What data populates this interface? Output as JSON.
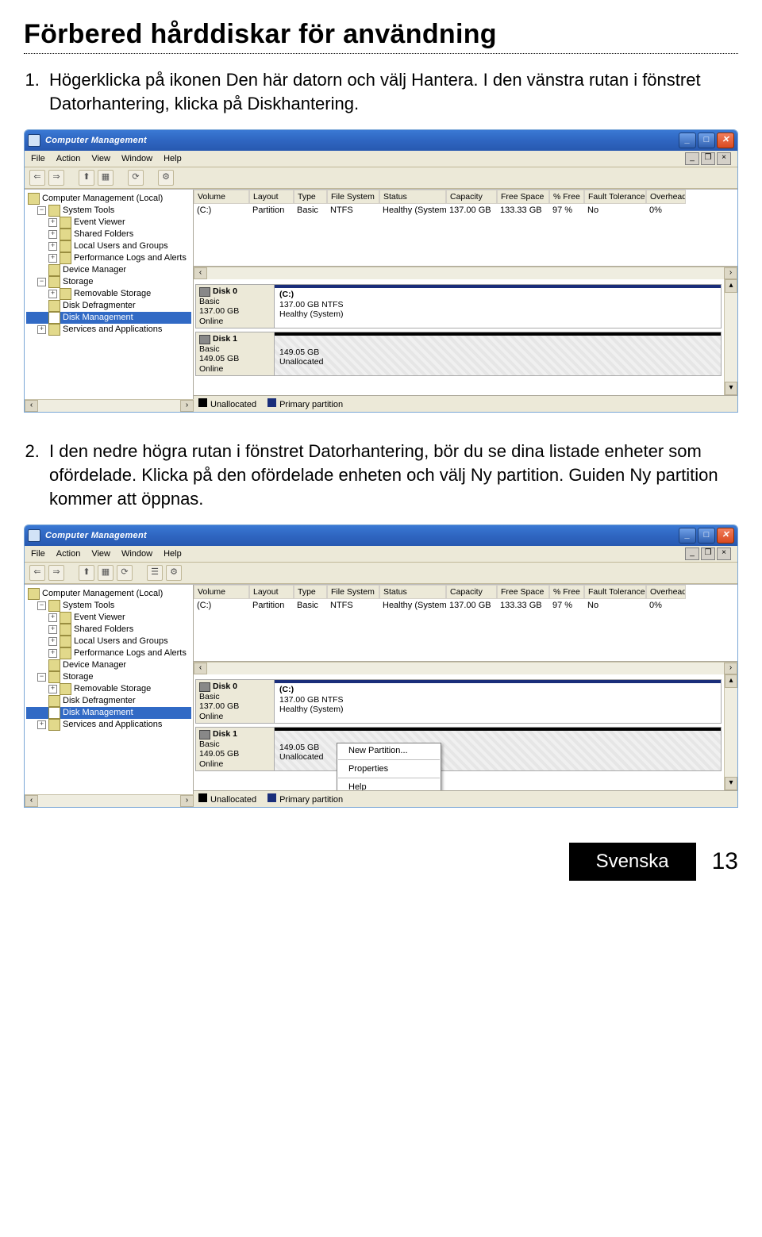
{
  "heading": "Förbered hårddiskar för användning",
  "step1": "Högerklicka på ikonen Den här datorn och välj Hantera. I den vänstra rutan i fönstret Datorhantering, klicka på Diskhantering.",
  "step2": "I den nedre högra rutan i fönstret Datorhantering, bör du se dina listade enheter som ofördelade. Klicka på den ofördelade enheten och välj Ny partition. Guiden Ny partition kommer att öppnas.",
  "window": {
    "title": "Computer Management",
    "menus": {
      "file": "File",
      "action": "Action",
      "view": "View",
      "window": "Window",
      "help": "Help"
    },
    "tree": {
      "root": "Computer Management (Local)",
      "system_tools": "System Tools",
      "event_viewer": "Event Viewer",
      "shared_folders": "Shared Folders",
      "local_users": "Local Users and Groups",
      "perf_logs": "Performance Logs and Alerts",
      "device_manager": "Device Manager",
      "storage": "Storage",
      "removable": "Removable Storage",
      "defrag": "Disk Defragmenter",
      "disk_mgmt": "Disk Management",
      "services": "Services and Applications"
    },
    "columns": {
      "volume": "Volume",
      "layout": "Layout",
      "type": "Type",
      "filesystem": "File System",
      "status": "Status",
      "capacity": "Capacity",
      "free": "Free Space",
      "pfree": "% Free",
      "fault": "Fault Tolerance",
      "overhead": "Overhead"
    },
    "row": {
      "volume": "(C:)",
      "layout": "Partition",
      "type": "Basic",
      "filesystem": "NTFS",
      "status": "Healthy (System)",
      "capacity": "137.00 GB",
      "free": "133.33 GB",
      "pfree": "97 %",
      "fault": "No",
      "overhead": "0%"
    },
    "disk0": {
      "name": "Disk 0",
      "type": "Basic",
      "size": "137.00 GB",
      "state": "Online",
      "part_name": "(C:)",
      "part_size": "137.00 GB NTFS",
      "part_status": "Healthy (System)"
    },
    "disk1": {
      "name": "Disk 1",
      "type": "Basic",
      "size": "149.05 GB",
      "state": "Online",
      "part_size": "149.05 GB",
      "part_status": "Unallocated"
    },
    "legend": {
      "unallocated": "Unallocated",
      "primary": "Primary partition"
    },
    "context": {
      "new_partition": "New Partition...",
      "properties": "Properties",
      "help": "Help"
    }
  },
  "footer": {
    "language": "Svenska",
    "page": "13"
  }
}
